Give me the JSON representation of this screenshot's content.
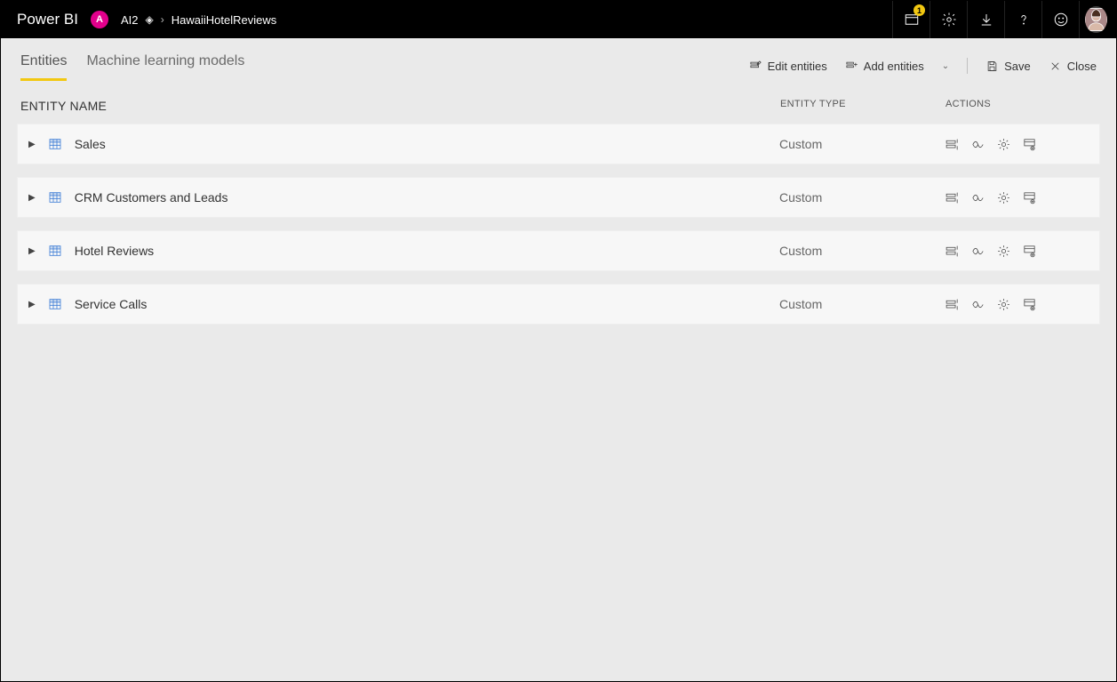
{
  "header": {
    "brand": "Power BI",
    "workspace_badge": "A",
    "workspace_name": "AI2",
    "breadcrumb_item": "HawaiiHotelReviews",
    "notification_count": "1"
  },
  "tabs": {
    "entities": "Entities",
    "ml_models": "Machine learning models"
  },
  "toolbar": {
    "edit_entities": "Edit entities",
    "add_entities": "Add entities",
    "save": "Save",
    "close": "Close"
  },
  "columns": {
    "name": "ENTITY NAME",
    "type": "ENTITY TYPE",
    "actions": "ACTIONS"
  },
  "entities": [
    {
      "name": "Sales",
      "type": "Custom"
    },
    {
      "name": "CRM Customers and Leads",
      "type": "Custom"
    },
    {
      "name": "Hotel Reviews",
      "type": "Custom"
    },
    {
      "name": "Service Calls",
      "type": "Custom"
    }
  ]
}
